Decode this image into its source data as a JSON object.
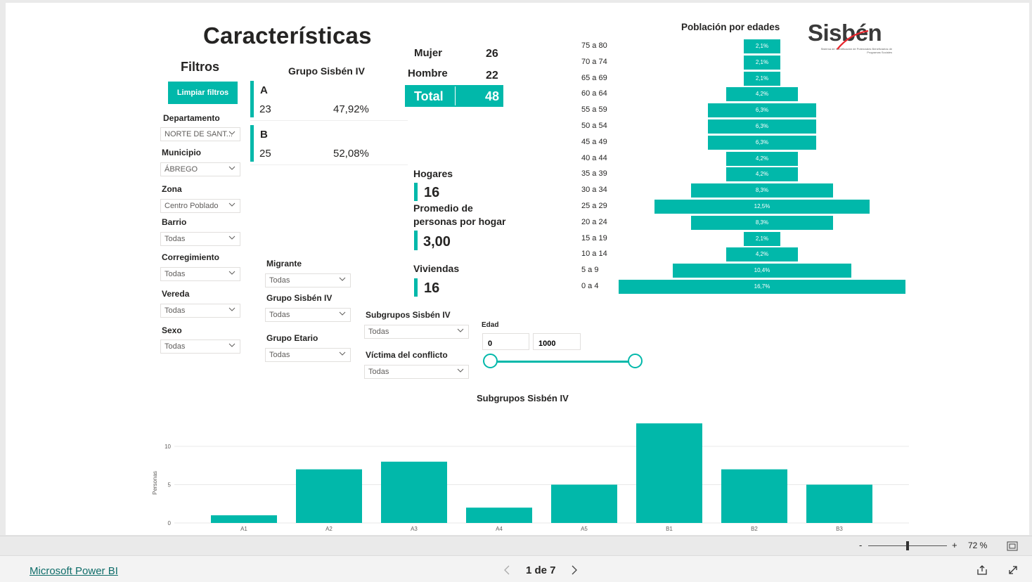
{
  "page": {
    "title": "Características",
    "logo_text": "Sisbén",
    "logo_tagline": "Sistema de Identificación de Potenciales Beneficiarios de Programas Sociales"
  },
  "filters": {
    "heading": "Filtros",
    "clear_button": "Limpiar filtros",
    "departamento": {
      "label": "Departamento",
      "value": "NORTE DE SANT..."
    },
    "municipio": {
      "label": "Municipio",
      "value": "ÁBREGO"
    },
    "zona": {
      "label": "Zona",
      "value": "Centro Poblado"
    },
    "barrio": {
      "label": "Barrio",
      "value": "Todas"
    },
    "corregimiento": {
      "label": "Corregimiento",
      "value": "Todas"
    },
    "vereda": {
      "label": "Vereda",
      "value": "Todas"
    },
    "sexo": {
      "label": "Sexo",
      "value": "Todas"
    },
    "migrante": {
      "label": "Migrante",
      "value": "Todas"
    },
    "grupo_sisben": {
      "label": "Grupo Sisbén IV",
      "value": "Todas"
    },
    "grupo_etario": {
      "label": "Grupo Etario",
      "value": "Todas"
    },
    "subgrupos": {
      "label": "Subgrupos Sisbén IV",
      "value": "Todas"
    },
    "victima": {
      "label": "Víctima del conflicto",
      "value": "Todas"
    },
    "edad": {
      "label": "Edad",
      "min": "0",
      "max": "1000"
    }
  },
  "grupo_card": {
    "title": "Grupo Sisbén IV",
    "rows": [
      {
        "group": "A",
        "count": "23",
        "pct": "47,92%"
      },
      {
        "group": "B",
        "count": "25",
        "pct": "52,08%"
      }
    ]
  },
  "sex_card": {
    "mujer_label": "Mujer",
    "mujer_value": "26",
    "hombre_label": "Hombre",
    "hombre_value": "22",
    "total_label": "Total",
    "total_value": "48"
  },
  "kpis": {
    "hogares_label": "Hogares",
    "hogares_value": "16",
    "promedio_label_1": "Promedio de",
    "promedio_label_2": "personas por hogar",
    "promedio_value": "3,00",
    "viviendas_label": "Viviendas",
    "viviendas_value": "16"
  },
  "colors": {
    "accent": "#01b8aa",
    "logo_red": "#e8262d",
    "text": "#252423"
  },
  "chart_data": [
    {
      "type": "bar",
      "title": "Población por edades",
      "orientation": "horizontal-centered",
      "categories": [
        "75 a 80",
        "70 a 74",
        "65 a 69",
        "60 a 64",
        "55 a 59",
        "50 a 54",
        "45 a 49",
        "40 a 44",
        "35 a 39",
        "30 a 34",
        "25 a 29",
        "20 a 24",
        "15 a 19",
        "10 a 14",
        "5 a 9",
        "0 a 4"
      ],
      "values": [
        2.1,
        2.1,
        2.1,
        4.2,
        6.3,
        6.3,
        6.3,
        4.2,
        4.2,
        8.3,
        12.5,
        8.3,
        2.1,
        4.2,
        10.4,
        16.7
      ],
      "labels": [
        "2,1%",
        "2,1%",
        "2,1%",
        "4,2%",
        "6,3%",
        "6,3%",
        "6,3%",
        "4,2%",
        "4,2%",
        "8,3%",
        "12,5%",
        "8,3%",
        "2,1%",
        "4,2%",
        "10,4%",
        "16,7%"
      ]
    },
    {
      "type": "bar",
      "title": "Subgrupos Sisbén IV",
      "categories": [
        "A1",
        "A2",
        "A3",
        "A4",
        "A5",
        "B1",
        "B2",
        "B3"
      ],
      "values": [
        1,
        7,
        8,
        2,
        5,
        13,
        7,
        5
      ],
      "ylabel": "Personas",
      "yticks": [
        "0",
        "5",
        "10"
      ],
      "ylim": [
        0,
        13
      ],
      "grid": true
    }
  ],
  "status_bar": {
    "zoom_minus": "-",
    "zoom_plus": "+",
    "zoom_label": "72 %",
    "zoom_level": 0.5
  },
  "footer": {
    "link": "Microsoft Power BI",
    "pagination": "1 de 7"
  }
}
